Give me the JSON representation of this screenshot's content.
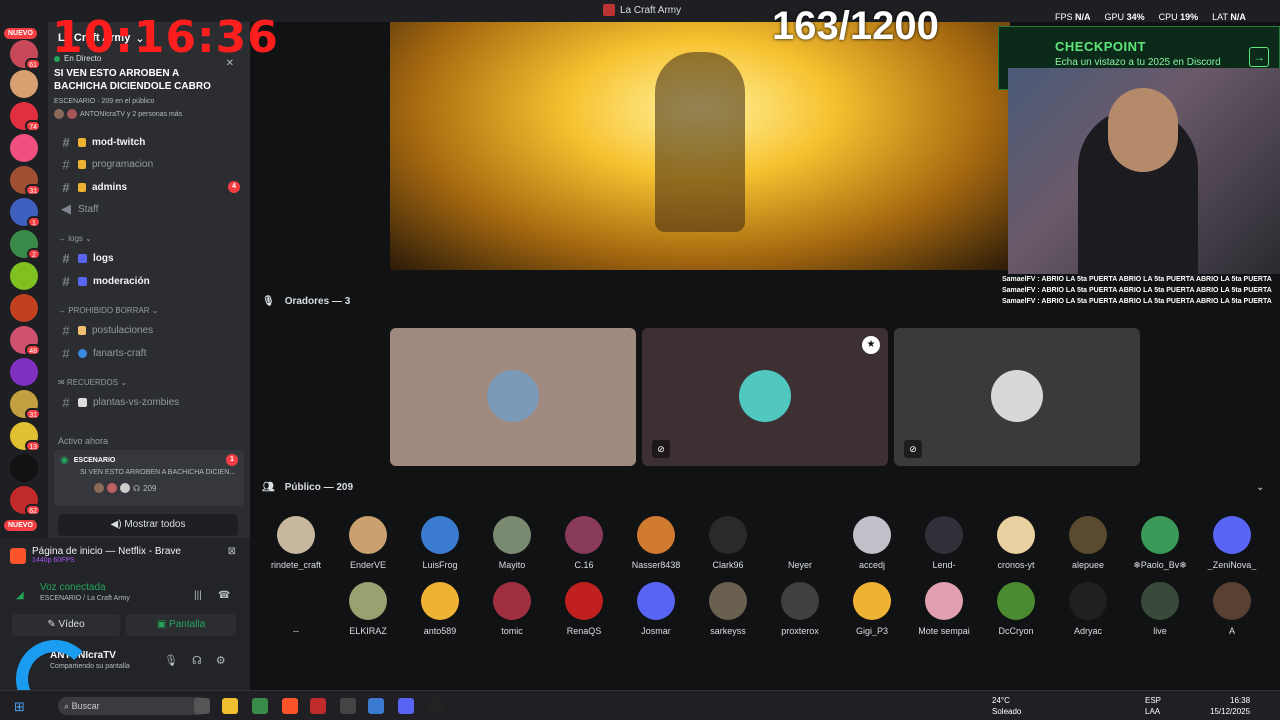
{
  "overlay": {
    "clock": "10:16:36",
    "counter": "163/1200",
    "perf": [
      {
        "label": "FPS",
        "value": "N/A"
      },
      {
        "label": "GPU",
        "value": "34%"
      },
      {
        "label": "CPU",
        "value": "19%"
      },
      {
        "label": "LAT",
        "value": "N/A"
      }
    ]
  },
  "window": {
    "title": "La Craft Army"
  },
  "server": {
    "name": "La Craft Army"
  },
  "live_card": {
    "tag": "En Directo",
    "title": "SI VEN ESTO ARROBEN A BACHICHA DICIENDOLE CABRO",
    "meta": "ESCENARIO · 209 en el público",
    "people": "ANTONIcraTV y 2 personas más"
  },
  "rail": {
    "nuevo_top": "NUEVO",
    "nuevo_bottom": "NUEVO",
    "badges": [
      "61",
      "74",
      "31",
      "1",
      "2",
      "48",
      "31",
      "13",
      "62"
    ]
  },
  "channels": [
    {
      "label": "mod-twitch",
      "bold": true
    },
    {
      "label": "programacion",
      "bold": false
    },
    {
      "label": "admins",
      "bold": true,
      "badge": "4"
    },
    {
      "label": "Staff",
      "bold": false
    },
    {
      "label": "logs",
      "bold": true
    },
    {
      "label": "moderación",
      "bold": true
    },
    {
      "label": "postulaciones",
      "bold": false
    },
    {
      "label": "fanarts-craft",
      "bold": false
    },
    {
      "label": "plantas-vs-zombies",
      "bold": false
    }
  ],
  "categories": {
    "logs": "logs",
    "prohibido": "PROHIBIDO BORRAR",
    "recuerdos": "RECUERDOS"
  },
  "active_now": {
    "heading": "Activo ahora",
    "stage_label": "ESCENARIO",
    "stage_badge": "1",
    "stage_title": "SI VEN ESTO ARROBEN A BACHICHA DICIEN...",
    "count": "209",
    "show_all": "Mostrar todos"
  },
  "bottom": {
    "brave_title": "Página de inicio — Netflix - Brave",
    "brave_sub": "1440p 60FPS",
    "voice_title": "Voz conectada",
    "voice_sub": "ESCENARIO / La Craft Army",
    "video_label": "Vídeo",
    "screen_label": "Pantalla",
    "username": "ANTONIcraTV",
    "user_status": "Compartiendo su pantalla"
  },
  "checkpoint": {
    "title": "CHECKPOINT",
    "subtitle": "Echa un vistazo a tu 2025 en Discord"
  },
  "chat": [
    "SamaelFV : ABRIO LA 5ta PUERTA ABRIO LA 5ta PUERTA ABRIO LA 5ta PUERTA",
    "SamaelFV : ABRIO LA 5ta PUERTA ABRIO LA 5ta PUERTA ABRIO LA 5ta PUERTA",
    "SamaelFV : ABRIO LA 5ta PUERTA ABRIO LA 5ta PUERTA ABRIO LA 5ta PUERTA"
  ],
  "speakers": {
    "heading": "Oradores — 3"
  },
  "audience": {
    "heading": "Público — 209",
    "members": [
      {
        "name": "rindete_craft",
        "color": "#c8b8a0"
      },
      {
        "name": "EnderVE",
        "color": "#caa070"
      },
      {
        "name": "LuisFrog",
        "color": "#3a7ad0"
      },
      {
        "name": "Mayito",
        "color": "#7a8a70"
      },
      {
        "name": "C.16",
        "color": "#8a3a5a"
      },
      {
        "name": "Nasser8438",
        "color": "#d07a30"
      },
      {
        "name": "Clark96",
        "color": "#2a2a2a"
      },
      {
        "name": "Neyer",
        "color": "#111111"
      },
      {
        "name": "accedj",
        "color": "#c0c0c8"
      },
      {
        "name": "Lend-",
        "color": "#303038"
      },
      {
        "name": "cronos-yt",
        "color": "#e8d0a0"
      },
      {
        "name": "alepuee",
        "color": "#5a4a30"
      },
      {
        "name": "❄Paolo_Bv❄",
        "color": "#3a9a5a"
      },
      {
        "name": "_ZeniNova_",
        "color": "#5865f2"
      },
      {
        "name": "--",
        "color": "#111214"
      },
      {
        "name": "ELKIRAZ",
        "color": "#9aa070"
      },
      {
        "name": "anto589",
        "color": "#f0b232"
      },
      {
        "name": "tomic",
        "color": "#a03040"
      },
      {
        "name": "RenaQS",
        "color": "#c02020"
      },
      {
        "name": "Josmar",
        "color": "#5865f2"
      },
      {
        "name": "sarkeyss",
        "color": "#6a6050"
      },
      {
        "name": "proxterox",
        "color": "#404040"
      },
      {
        "name": "Gigi_P3",
        "color": "#f0b232"
      },
      {
        "name": "Mote sempai",
        "color": "#e0a0b0"
      },
      {
        "name": "DcCryon",
        "color": "#4a8a30"
      },
      {
        "name": "Adryac",
        "color": "#202020"
      },
      {
        "name": "live",
        "color": "#3a4a3a"
      },
      {
        "name": "A",
        "color": "#5a4030"
      }
    ]
  },
  "taskbar": {
    "search": "Buscar",
    "temp": "24°C",
    "weather": "Soleado",
    "lang": "ESP",
    "lang_sub": "LAA",
    "time": "16:38",
    "date": "15/12/2025"
  }
}
